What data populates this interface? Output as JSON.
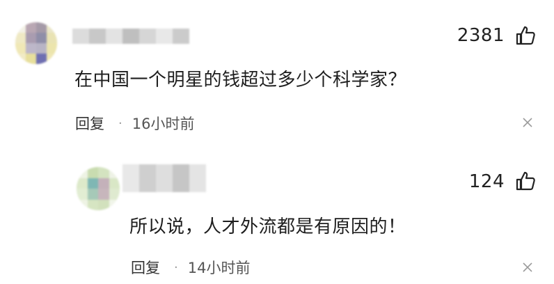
{
  "comments": [
    {
      "like_count": "2381",
      "text": "在中国一个明星的钱超过多少个科学家？",
      "reply_label": "回复",
      "separator": "·",
      "time": "16小时前"
    },
    {
      "like_count": "124",
      "text": "所以说，人才外流都是有原因的！",
      "reply_label": "回复",
      "separator": "·",
      "time": "14小时前"
    }
  ],
  "icons": {
    "like": "thumbs-up-icon",
    "dismiss": "close-icon"
  },
  "colors": {
    "text": "#1e1e1e",
    "meta": "#555555",
    "dismiss": "#9a9a9a"
  }
}
